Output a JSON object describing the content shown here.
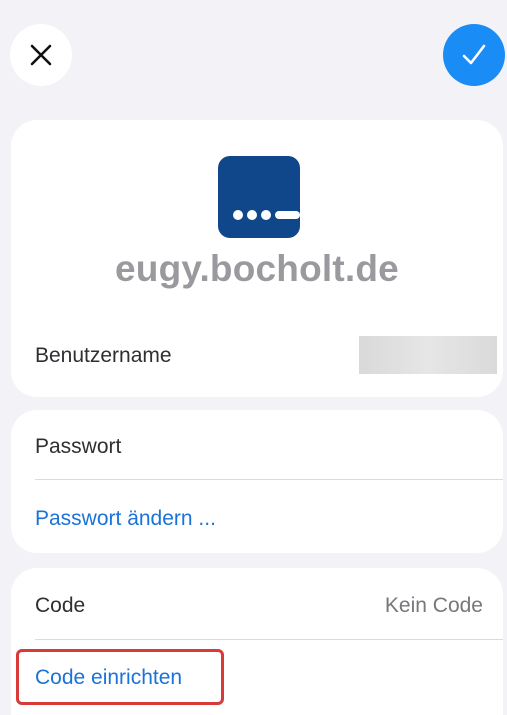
{
  "header": {
    "close_icon": "close-icon",
    "done_icon": "checkmark-icon",
    "accent_color": "#1a8cf5"
  },
  "account": {
    "app_icon": "app-icon-dots",
    "domain": "eugy.bocholt.de",
    "username_label": "Benutzername"
  },
  "password": {
    "label": "Passwort",
    "change_link": "Passwort ändern ..."
  },
  "code": {
    "label": "Code",
    "value": "Kein Code",
    "setup_link": "Code einrichten"
  }
}
